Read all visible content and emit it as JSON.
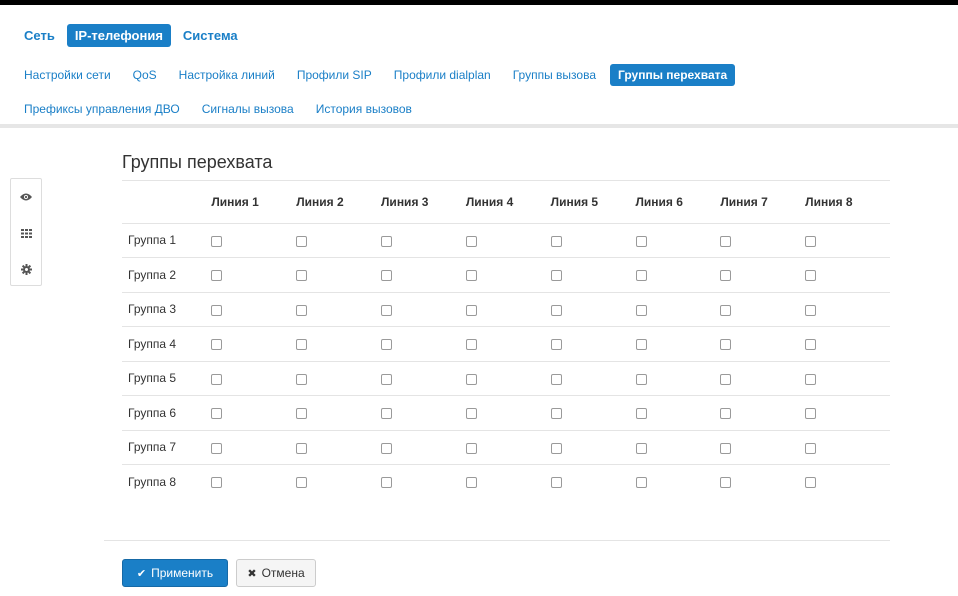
{
  "top_nav": [
    {
      "label": "Сеть",
      "active": false
    },
    {
      "label": "IP-телефония",
      "active": true
    },
    {
      "label": "Система",
      "active": false
    }
  ],
  "sub_nav_row1": [
    {
      "label": "Настройки сети",
      "active": false
    },
    {
      "label": "QoS",
      "active": false
    },
    {
      "label": "Настройка линий",
      "active": false
    },
    {
      "label": "Профили SIP",
      "active": false
    },
    {
      "label": "Профили dialplan",
      "active": false
    },
    {
      "label": "Группы вызова",
      "active": false
    },
    {
      "label": "Группы перехвата",
      "active": true
    }
  ],
  "sub_nav_row2": [
    {
      "label": "Префиксы управления ДВО",
      "active": false
    },
    {
      "label": "Сигналы вызова",
      "active": false
    },
    {
      "label": "История вызовов",
      "active": false
    }
  ],
  "side_tools": [
    "eye-icon",
    "grid-icon",
    "gear-icon"
  ],
  "page": {
    "title": "Группы перехвата",
    "columns": [
      "Линия 1",
      "Линия 2",
      "Линия 3",
      "Линия 4",
      "Линия 5",
      "Линия 6",
      "Линия 7",
      "Линия 8"
    ],
    "rows": [
      {
        "label": "Группа 1",
        "checked": [
          false,
          false,
          false,
          false,
          false,
          false,
          false,
          false
        ]
      },
      {
        "label": "Группа 2",
        "checked": [
          false,
          false,
          false,
          false,
          false,
          false,
          false,
          false
        ]
      },
      {
        "label": "Группа 3",
        "checked": [
          false,
          false,
          false,
          false,
          false,
          false,
          false,
          false
        ]
      },
      {
        "label": "Группа 4",
        "checked": [
          false,
          false,
          false,
          false,
          false,
          false,
          false,
          false
        ]
      },
      {
        "label": "Группа 5",
        "checked": [
          false,
          false,
          false,
          false,
          false,
          false,
          false,
          false
        ]
      },
      {
        "label": "Группа 6",
        "checked": [
          false,
          false,
          false,
          false,
          false,
          false,
          false,
          false
        ]
      },
      {
        "label": "Группа 7",
        "checked": [
          false,
          false,
          false,
          false,
          false,
          false,
          false,
          false
        ]
      },
      {
        "label": "Группа 8",
        "checked": [
          false,
          false,
          false,
          false,
          false,
          false,
          false,
          false
        ]
      }
    ]
  },
  "actions": {
    "apply_label": "Применить",
    "cancel_label": "Отмена"
  },
  "colors": {
    "accent": "#1a7fc7"
  }
}
